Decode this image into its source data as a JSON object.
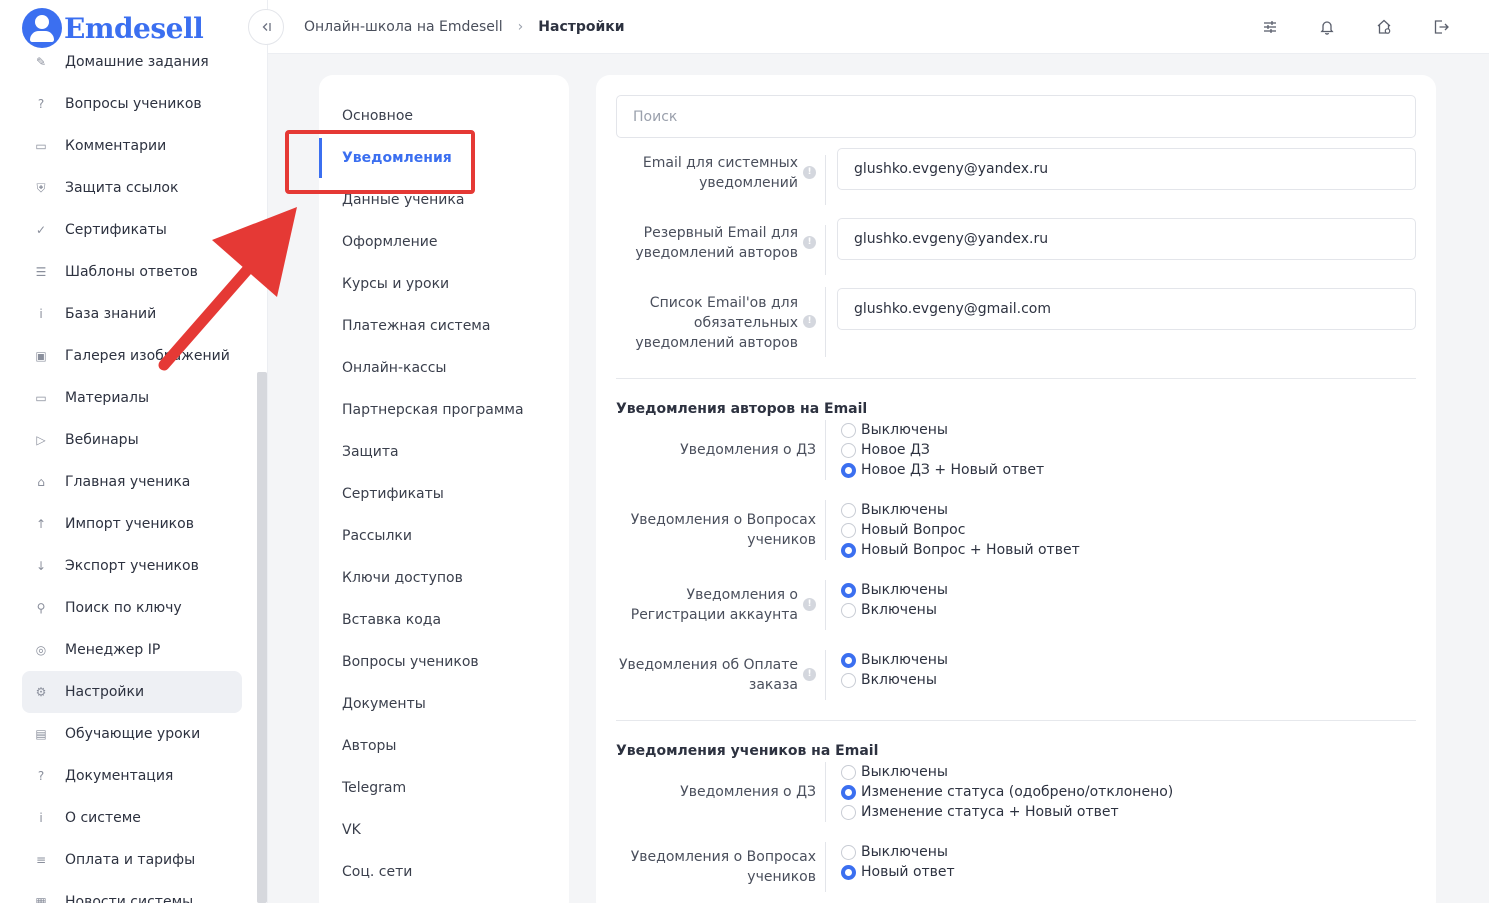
{
  "brand": {
    "name": "Emdesell"
  },
  "sidebar": {
    "items": [
      {
        "label": "Домашние задания",
        "icon": "pencil-icon"
      },
      {
        "label": "Вопросы учеников",
        "icon": "question-circle-icon"
      },
      {
        "label": "Комментарии",
        "icon": "comment-icon"
      },
      {
        "label": "Защита ссылок",
        "icon": "shield-icon"
      },
      {
        "label": "Сертификаты",
        "icon": "badge-icon"
      },
      {
        "label": "Шаблоны ответов",
        "icon": "list-icon"
      },
      {
        "label": "База знаний",
        "icon": "info-icon"
      },
      {
        "label": "Галерея изображений",
        "icon": "image-icon"
      },
      {
        "label": "Материалы",
        "icon": "briefcase-icon"
      },
      {
        "label": "Вебинары",
        "icon": "play-icon"
      },
      {
        "label": "Главная ученика",
        "icon": "home-icon"
      },
      {
        "label": "Импорт учеников",
        "icon": "upload-icon"
      },
      {
        "label": "Экспорт учеников",
        "icon": "download-icon"
      },
      {
        "label": "Поиск по ключу",
        "icon": "search-icon"
      },
      {
        "label": "Менеджер IP",
        "icon": "target-icon"
      },
      {
        "label": "Настройки",
        "icon": "gear-icon",
        "active": true
      },
      {
        "label": "Обучающие уроки",
        "icon": "film-icon"
      },
      {
        "label": "Документация",
        "icon": "help-box-icon"
      },
      {
        "label": "О системе",
        "icon": "info-box-icon"
      },
      {
        "label": "Оплата и тарифы",
        "icon": "receipt-icon"
      },
      {
        "label": "Новости системы",
        "icon": "news-icon"
      }
    ]
  },
  "header": {
    "breadcrumb": [
      "Онлайн-школа на Emdesell",
      "Настройки"
    ],
    "icons": [
      "sliders-icon",
      "bell-icon",
      "home-settings-icon",
      "logout-icon"
    ]
  },
  "settings_nav": {
    "items": [
      {
        "label": "Основное"
      },
      {
        "label": "Уведомления",
        "active": true
      },
      {
        "label": "Данные ученика"
      },
      {
        "label": "Оформление"
      },
      {
        "label": "Курсы и уроки"
      },
      {
        "label": "Платежная система"
      },
      {
        "label": "Онлайн-кассы"
      },
      {
        "label": "Партнерская программа"
      },
      {
        "label": "Защита"
      },
      {
        "label": "Сертификаты"
      },
      {
        "label": "Рассылки"
      },
      {
        "label": "Ключи доступов"
      },
      {
        "label": "Вставка кода"
      },
      {
        "label": "Вопросы учеников"
      },
      {
        "label": "Документы"
      },
      {
        "label": "Авторы"
      },
      {
        "label": "Telegram"
      },
      {
        "label": "VK"
      },
      {
        "label": "Соц. сети"
      }
    ]
  },
  "main": {
    "search_placeholder": "Поиск",
    "emails": [
      {
        "label_lines": [
          "Email для системных",
          "уведомлений"
        ],
        "value": "glushko.evgeny@yandex.ru"
      },
      {
        "label_lines": [
          "Резервный Email для",
          "уведомлений авторов"
        ],
        "value": "glushko.evgeny@yandex.ru"
      },
      {
        "label_lines": [
          "Список Email'ов для",
          "обязательных",
          "уведомлений авторов"
        ],
        "value": "glushko.evgeny@gmail.com"
      }
    ],
    "author_section": {
      "title": "Уведомления авторов на Email",
      "groups": [
        {
          "label_lines": [
            "Уведомления о ДЗ"
          ],
          "options": [
            "Выключены",
            "Новое ДЗ",
            "Новое ДЗ + Новый ответ"
          ],
          "selected": 2
        },
        {
          "label_lines": [
            "Уведомления о Вопросах",
            "учеников"
          ],
          "options": [
            "Выключены",
            "Новый Вопрос",
            "Новый Вопрос + Новый ответ"
          ],
          "selected": 2
        },
        {
          "label_lines": [
            "Уведомления о",
            "Регистрации аккаунта"
          ],
          "options": [
            "Выключены",
            "Включены"
          ],
          "selected": 0
        },
        {
          "label_lines": [
            "Уведомления об Оплате",
            "заказа"
          ],
          "options": [
            "Выключены",
            "Включены"
          ],
          "selected": 0
        }
      ]
    },
    "student_section": {
      "title": "Уведомления учеников на Email",
      "groups": [
        {
          "label_lines": [
            "Уведомления о ДЗ"
          ],
          "options": [
            "Выключены",
            "Изменение статуса (одобрено/отклонено)",
            "Изменение статуса + Новый ответ"
          ],
          "selected": 1
        },
        {
          "label_lines": [
            "Уведомления о Вопросах",
            "учеников"
          ],
          "options": [
            "Выключены",
            "Новый ответ"
          ],
          "selected": 1
        }
      ]
    }
  },
  "colors": {
    "accent": "#3b6ff0",
    "annotation": "#e53935"
  }
}
